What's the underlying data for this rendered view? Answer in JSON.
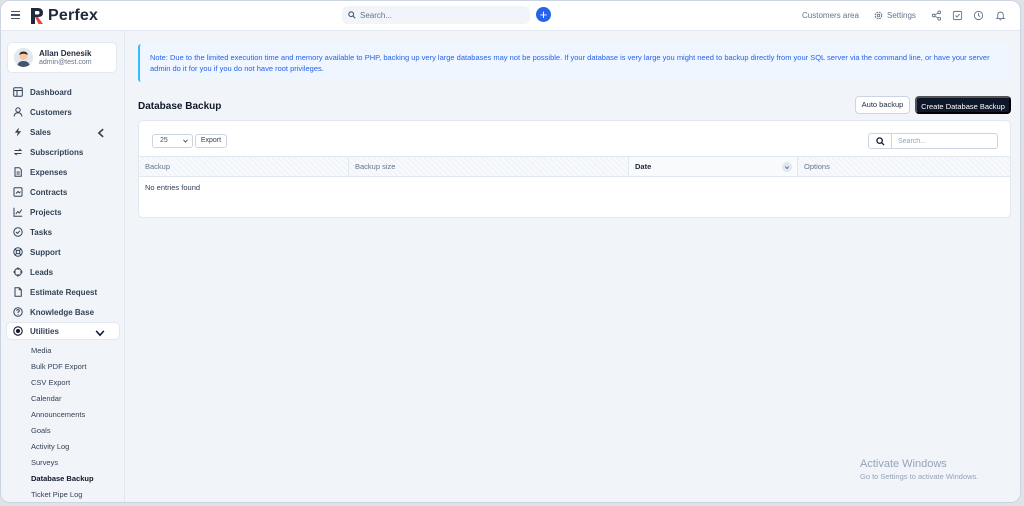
{
  "header": {
    "brand": "Perfex",
    "search_placeholder": "Search...",
    "customers_area": "Customers area",
    "settings": "Settings",
    "colors": {
      "accent": "#2563eb",
      "dark": "#0f172a"
    }
  },
  "profile": {
    "name": "Allan Denesik",
    "email": "admin@test.com"
  },
  "sidebar": {
    "items": [
      {
        "label": "Dashboard",
        "icon": "dashboard-icon"
      },
      {
        "label": "Customers",
        "icon": "user-icon"
      },
      {
        "label": "Sales",
        "icon": "bolt-icon"
      },
      {
        "label": "Subscriptions",
        "icon": "refresh-icon"
      },
      {
        "label": "Expenses",
        "icon": "document-icon"
      },
      {
        "label": "Contracts",
        "icon": "contract-icon"
      },
      {
        "label": "Projects",
        "icon": "chart-icon"
      },
      {
        "label": "Tasks",
        "icon": "check-circle-icon"
      },
      {
        "label": "Support",
        "icon": "lifebuoy-icon"
      },
      {
        "label": "Leads",
        "icon": "target-icon"
      },
      {
        "label": "Estimate Request",
        "icon": "file-icon"
      },
      {
        "label": "Knowledge Base",
        "icon": "question-icon"
      },
      {
        "label": "Utilities",
        "icon": "radio-icon"
      }
    ],
    "utilities_sub": [
      "Media",
      "Bulk PDF Export",
      "CSV Export",
      "Calendar",
      "Announcements",
      "Goals",
      "Activity Log",
      "Surveys",
      "Database Backup",
      "Ticket Pipe Log"
    ]
  },
  "main": {
    "note": "Note: Due to the limited execution time and memory available to PHP, backing up very large databases may not be possible. If your database is very large you might need to backup directly from your SQL server via the command line, or have your server admin do it for you if you do not have root privileges.",
    "title": "Database Backup",
    "auto_backup": "Auto backup",
    "create_backup": "Create Database Backup",
    "table": {
      "page_length": "25",
      "export": "Export",
      "search_placeholder": "Search...",
      "columns": [
        "Backup",
        "Backup size",
        "Date",
        "Options"
      ],
      "empty": "No entries found"
    }
  },
  "watermark": {
    "title": "Activate Windows",
    "subtitle": "Go to Settings to activate Windows."
  }
}
